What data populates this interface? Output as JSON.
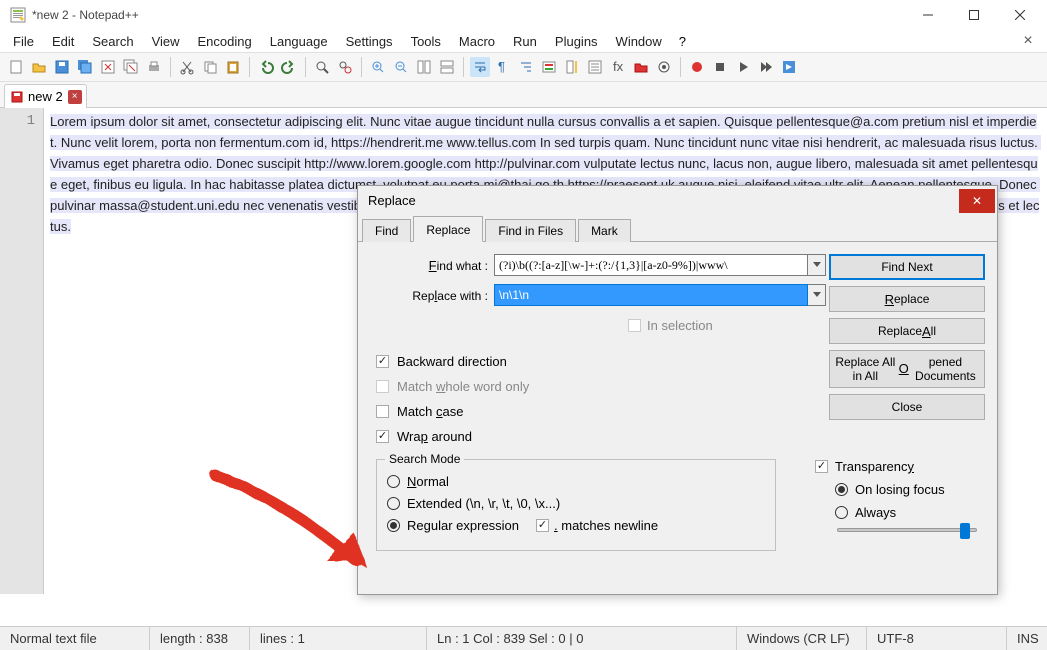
{
  "window": {
    "title": "*new 2 - Notepad++"
  },
  "menus": [
    "File",
    "Edit",
    "Search",
    "View",
    "Encoding",
    "Language",
    "Settings",
    "Tools",
    "Macro",
    "Run",
    "Plugins",
    "Window"
  ],
  "help_label": "?",
  "doc_tab": {
    "label": "new 2"
  },
  "gutter": {
    "line1": "1"
  },
  "code_text": "Lorem ipsum dolor sit amet, consectetur adipiscing elit. Nunc vitae augue tincidunt nulla cursus convallis a et sapien. Quisque pellentesque@a.com pretium nisl et imperdiet. Nunc velit lorem, porta non fermentum.com id, https://hendrerit.me www.tellus.com In sed turpis quam. Nunc tincidunt nunc vitae nisi hendrerit, ac malesuada risus luctus. Vivamus eget pharetra odio. Donec suscipit http://www.lorem.google.com http://pulvinar.com vulputate lectus nunc, lacus non, augue libero, malesuada sit amet pellentesque eget, finibus eu ligula. In hac habitasse platea dictumst. volutpat eu porta mi@thai.go.th https://praesent.uk augue nisi, eleifend vitae ultr elit. Aenean pellentesque. Donec pulvinar massa@student.uni.edu nec venenatis vestibulum. Pellentesque hendrerit, nisi sed cursus molestie, libero sem pharetra quam, vitae scelerisque augue tellus et lectus.",
  "status": {
    "file_type": "Normal text file",
    "length": "length : 838",
    "lines": "lines : 1",
    "pos": "Ln : 1    Col : 839    Sel : 0 | 0",
    "eol": "Windows (CR LF)",
    "enc": "UTF-8",
    "mode": "INS"
  },
  "dialog": {
    "title": "Replace",
    "tabs": [
      "Find",
      "Replace",
      "Find in Files",
      "Mark"
    ],
    "active_tab": 1,
    "find_label": "Find what :",
    "find_value": "(?i)\\b((?:[a-z][\\w-]+:(?:/{1,3}|[a-z0-9%])|www\\",
    "replace_label": "Replace with :",
    "replace_value": "\\n\\1\\n",
    "in_selection": "In selection",
    "backward": "Backward direction",
    "whole_word": "Match whole word only",
    "match_case": "Match case",
    "wrap": "Wrap around",
    "buttons": {
      "find_next": "Find Next",
      "replace": "Replace",
      "replace_all": "Replace All",
      "replace_all_opened": "Replace All in All Opened Documents",
      "close": "Close"
    },
    "search_mode": {
      "legend": "Search Mode",
      "normal": "Normal",
      "extended": "Extended (\\n, \\r, \\t, \\0, \\x...)",
      "regex": "Regular expression",
      "matches_newline": ". matches newline"
    },
    "transparency": {
      "label": "Transparency",
      "losing_focus": "On losing focus",
      "always": "Always"
    }
  }
}
